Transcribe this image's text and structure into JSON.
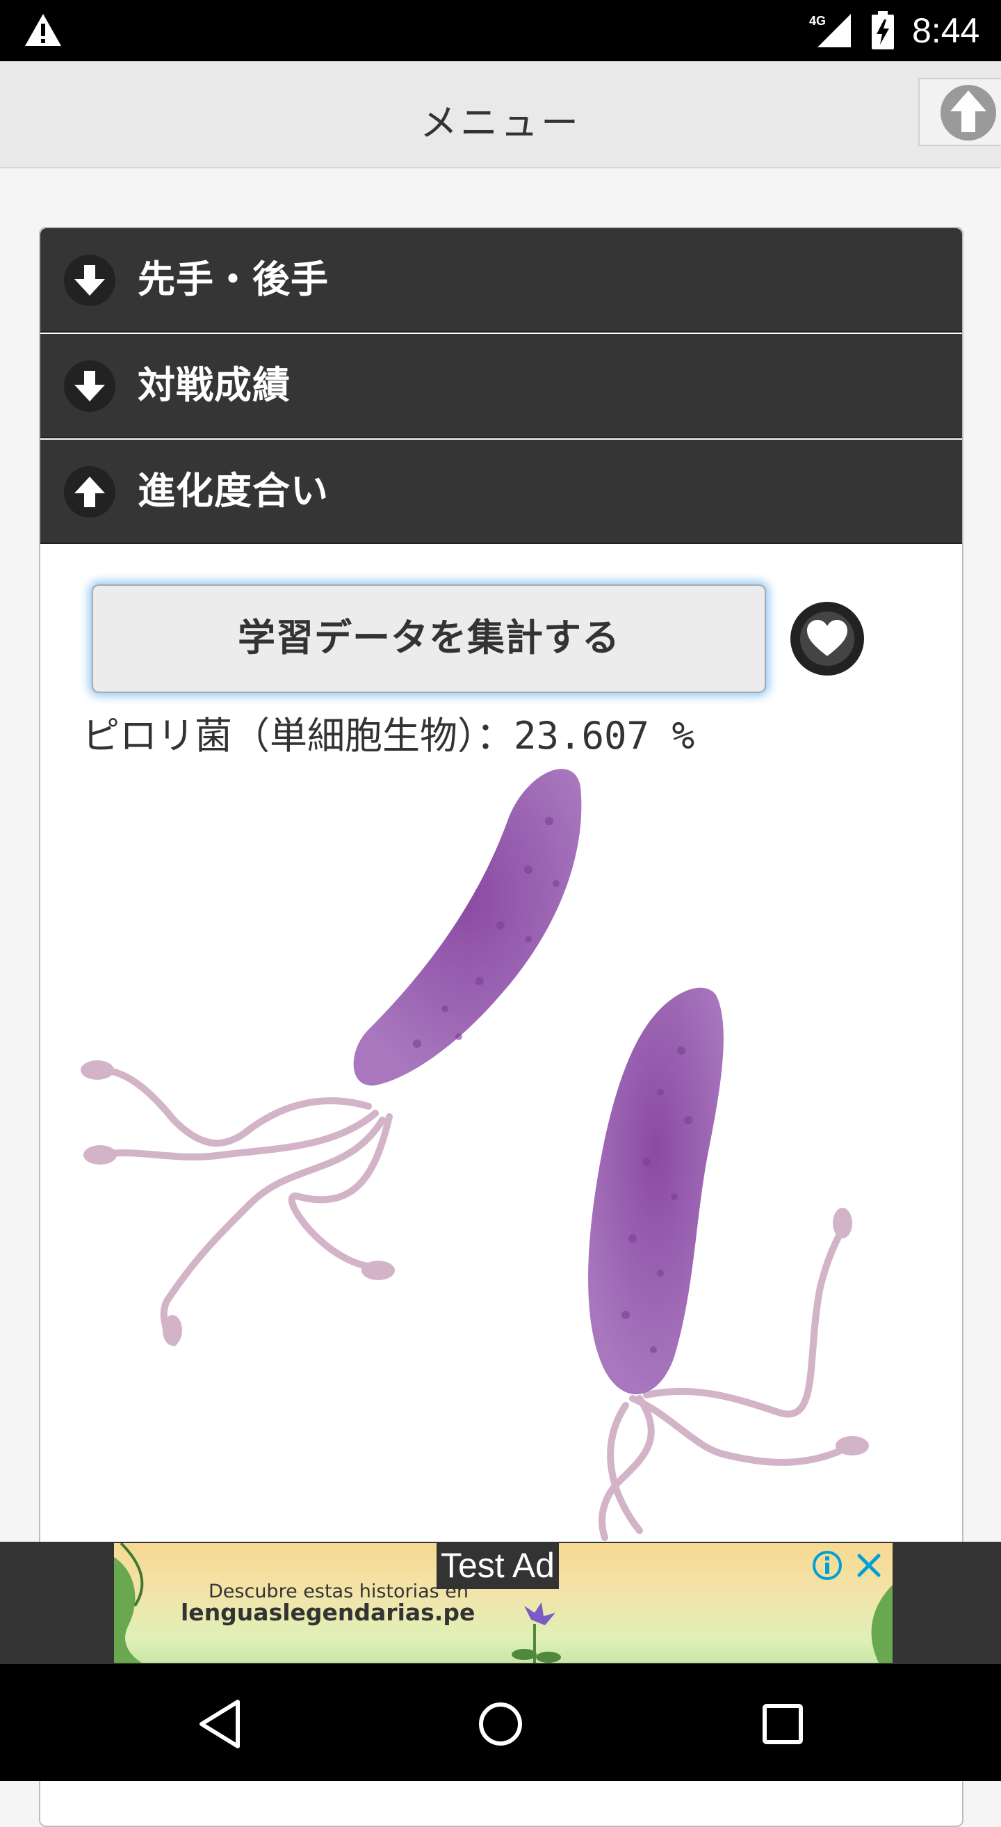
{
  "status_bar": {
    "network": "4G",
    "time": "8:44",
    "icons": [
      "warning-icon",
      "cellular-signal-icon",
      "battery-charging-icon"
    ]
  },
  "header": {
    "title": "メニュー",
    "up_icon": "arrow-up-circle-icon"
  },
  "accordion": {
    "items": [
      {
        "label": "先手・後手",
        "icon": "arrow-down-circle-icon",
        "expanded": false
      },
      {
        "label": "対戦成績",
        "icon": "arrow-down-circle-icon",
        "expanded": false
      },
      {
        "label": "進化度合い",
        "icon": "arrow-up-circle-icon",
        "expanded": true
      }
    ]
  },
  "content": {
    "aggregate_button": "学習データを集計する",
    "favorite_icon": "heart-icon",
    "stat_label": "ピロリ菌（単細胞生物）",
    "stat_value": "：23.607 %",
    "illustration": "bacteria-illustration"
  },
  "ad": {
    "badge": "Test Ad",
    "line1": "Descubre estas historias en",
    "line2": "lenguaslegendarias.pe",
    "info_icon": "info-icon",
    "close_icon": "close-icon"
  },
  "nav_bar": {
    "icons": [
      "back-icon",
      "home-icon",
      "recents-icon"
    ]
  },
  "colors": {
    "accordion_bg": "#353535",
    "bacteria_body": "#9b5fae",
    "flagella": "#d2b3c8",
    "focus_glow": "#8ec5f5"
  }
}
